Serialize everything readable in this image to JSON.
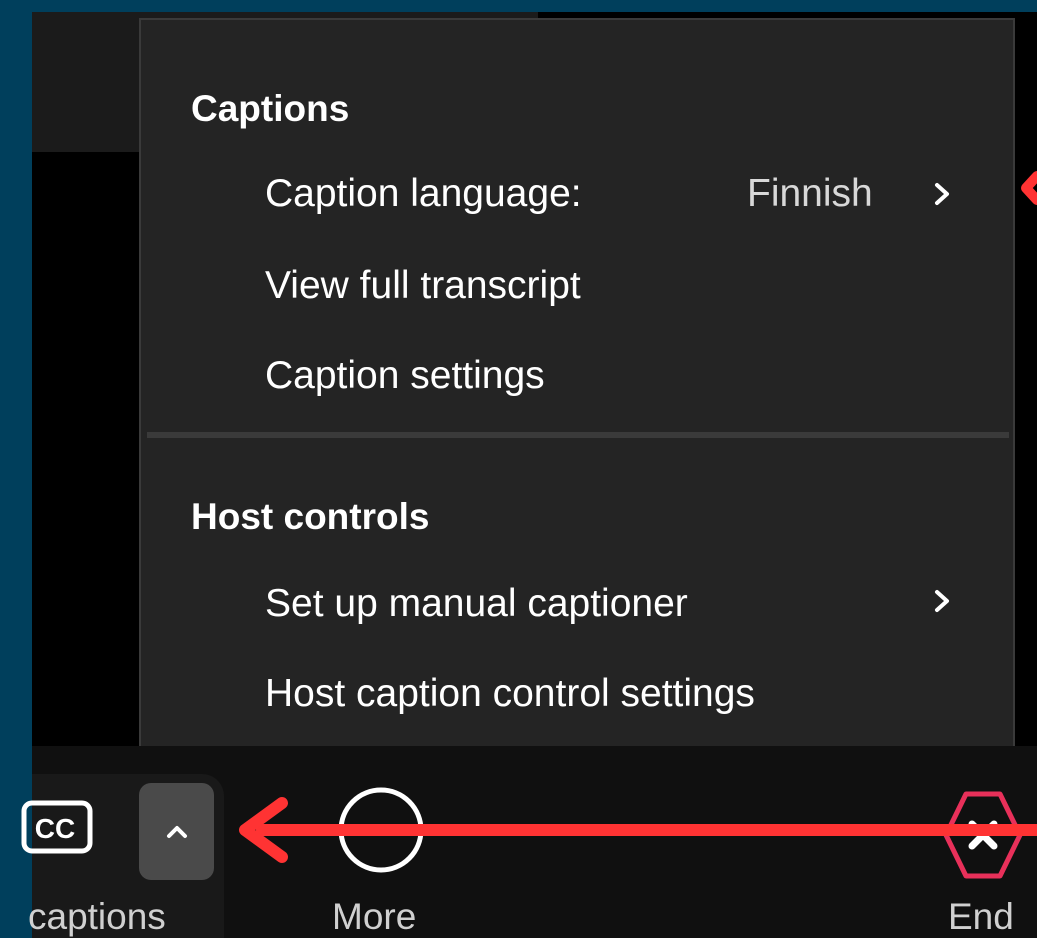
{
  "menu": {
    "captions_header": "Captions",
    "caption_language_label": "Caption language:",
    "caption_language_value": "Finnish",
    "view_transcript": "View full transcript",
    "caption_settings": "Caption settings",
    "host_header": "Host controls",
    "manual_captioner": "Set up manual captioner",
    "host_caption_settings": "Host caption control settings"
  },
  "toolbar": {
    "captions_label": "captions",
    "more_label": "More",
    "end_label": "End"
  },
  "icons": {
    "cc": "cc-icon",
    "caret": "chevron-up-icon",
    "more": "more-icon",
    "end": "end-call-icon",
    "submenu": "chevron-right-icon"
  },
  "colors": {
    "menu_bg": "#242424",
    "annotation_arrow": "#ff3333",
    "end_button": "#e8305a",
    "frame": "#003f5c"
  }
}
